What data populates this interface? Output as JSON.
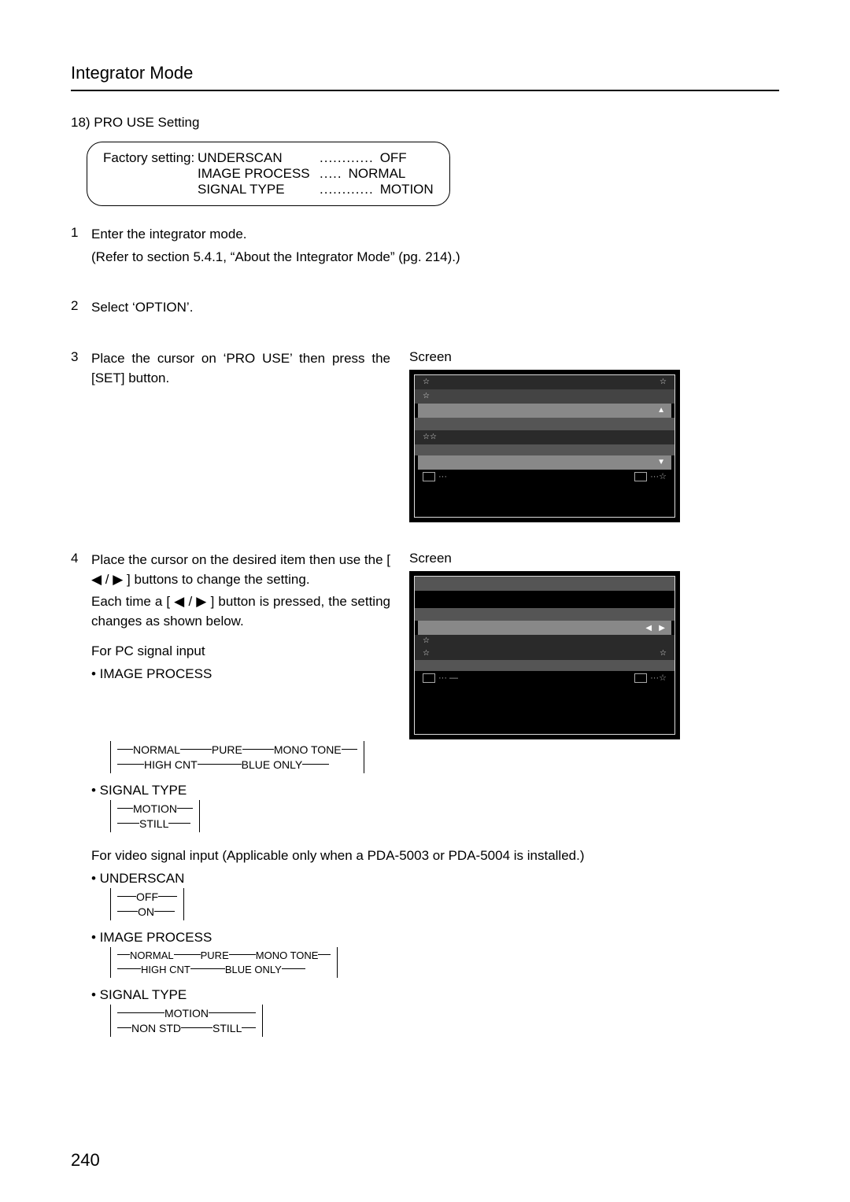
{
  "title": "Integrator Mode",
  "page_number": "240",
  "subheading": "18) PRO USE Setting",
  "factory": {
    "label": "Factory setting:",
    "rows": [
      {
        "key": "UNDERSCAN",
        "dots": "............",
        "val": "OFF"
      },
      {
        "key": "IMAGE PROCESS",
        "dots": ".....",
        "val": "NORMAL"
      },
      {
        "key": "SIGNAL TYPE",
        "dots": "............",
        "val": "MOTION"
      }
    ]
  },
  "steps": {
    "s1_num": "1",
    "s1_l1": "Enter the integrator mode.",
    "s1_l2": "(Refer to section 5.4.1, “About the Integrator Mode” (pg. 214).)",
    "s2_num": "2",
    "s2_l1": "Select ‘OPTION’.",
    "s3_num": "3",
    "s3_l1": "Place the cursor on ‘PRO USE’ then press the [SET] button.",
    "s4_num": "4",
    "s4_l1": "Place the cursor on the desired item then use the [ ◀ / ▶ ] buttons to change the setting.",
    "s4_l2": "Each time a [ ◀ / ▶ ] button is pressed, the setting changes as shown below."
  },
  "screen_label": "Screen",
  "pc_heading": "For PC signal input",
  "image_process_label": "• IMAGE PROCESS",
  "signal_type_label": "• SIGNAL TYPE",
  "underscan_label": "• UNDERSCAN",
  "video_heading": "For video signal input (Applicable only when a PDA-5003 or PDA-5004 is installed.)",
  "cycle_img_proc": [
    "NORMAL",
    "PURE",
    "MONO TONE",
    "HIGH CNT",
    "BLUE ONLY"
  ],
  "cycle_signal_pc": [
    "MOTION",
    "STILL"
  ],
  "cycle_underscan": [
    "OFF",
    "ON"
  ],
  "cycle_signal_video": [
    "MOTION",
    "NON STD",
    "STILL"
  ]
}
